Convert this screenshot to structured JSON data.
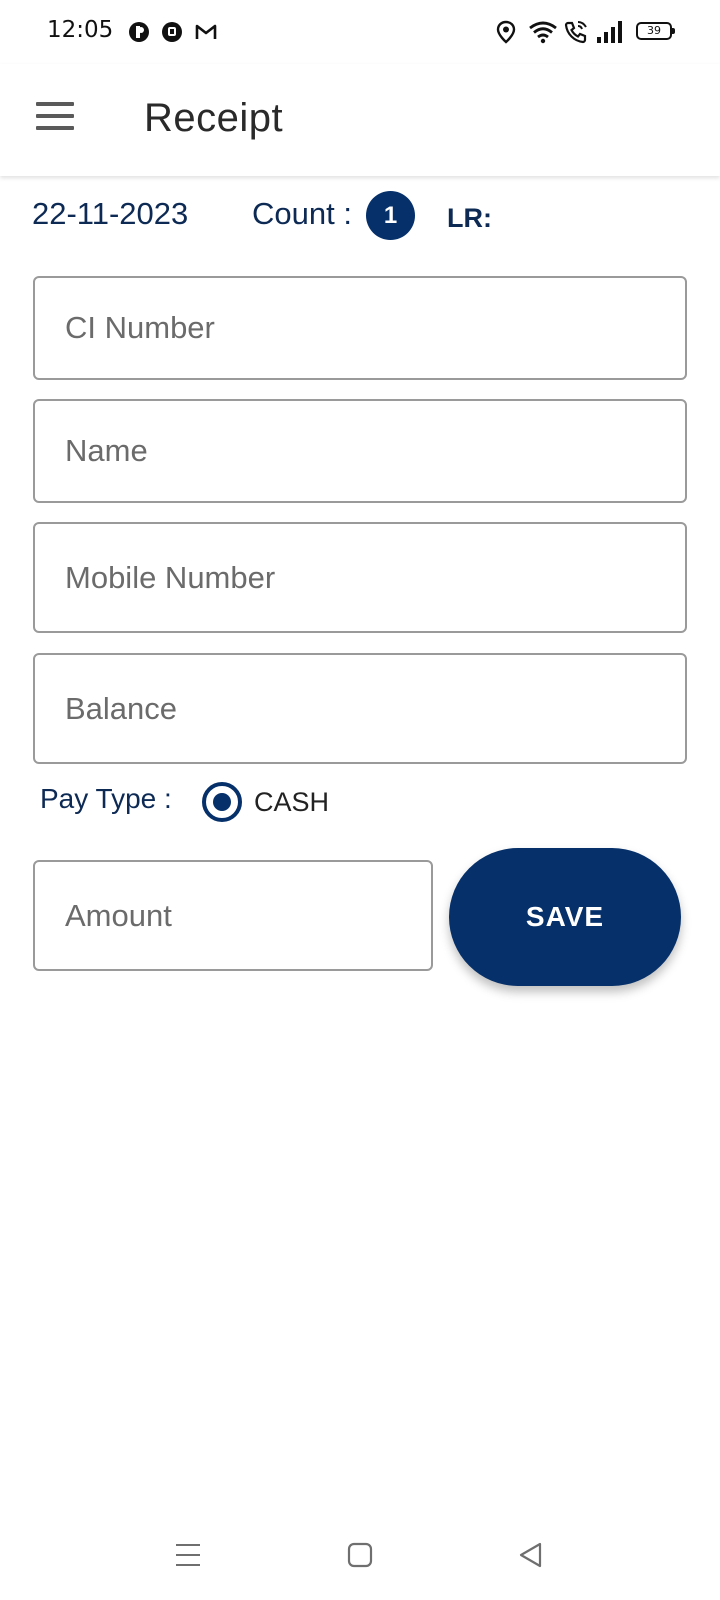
{
  "status_bar": {
    "time": "12:05",
    "battery": "39",
    "notification_icons": [
      "circle-dark-icon",
      "circle-dark-icon",
      "gmail-icon"
    ],
    "right_icons": [
      "location-icon",
      "wifi-icon",
      "wifi-call-icon",
      "signal-icon",
      "battery-icon"
    ]
  },
  "app_bar": {
    "title": "Receipt",
    "menu_icon": "menu-icon"
  },
  "info": {
    "date": "22-11-2023",
    "count_label": "Count :",
    "count_value": "1",
    "lr_label": "LR:"
  },
  "form": {
    "ci_number": {
      "placeholder": "CI Number",
      "value": ""
    },
    "name": {
      "placeholder": "Name",
      "value": ""
    },
    "mobile_number": {
      "placeholder": "Mobile Number",
      "value": ""
    },
    "balance": {
      "placeholder": "Balance",
      "value": ""
    },
    "pay_type_label": "Pay Type :",
    "pay_type_option": "CASH",
    "pay_type_selected": true,
    "amount": {
      "placeholder": "Amount",
      "value": ""
    },
    "save_label": "SAVE"
  },
  "colors": {
    "primary": "#05306a",
    "label_text": "#0d2a55",
    "field_border": "#9a9a9a"
  },
  "nav_bar": {
    "icons": [
      "recents-icon",
      "home-icon",
      "back-icon"
    ]
  }
}
